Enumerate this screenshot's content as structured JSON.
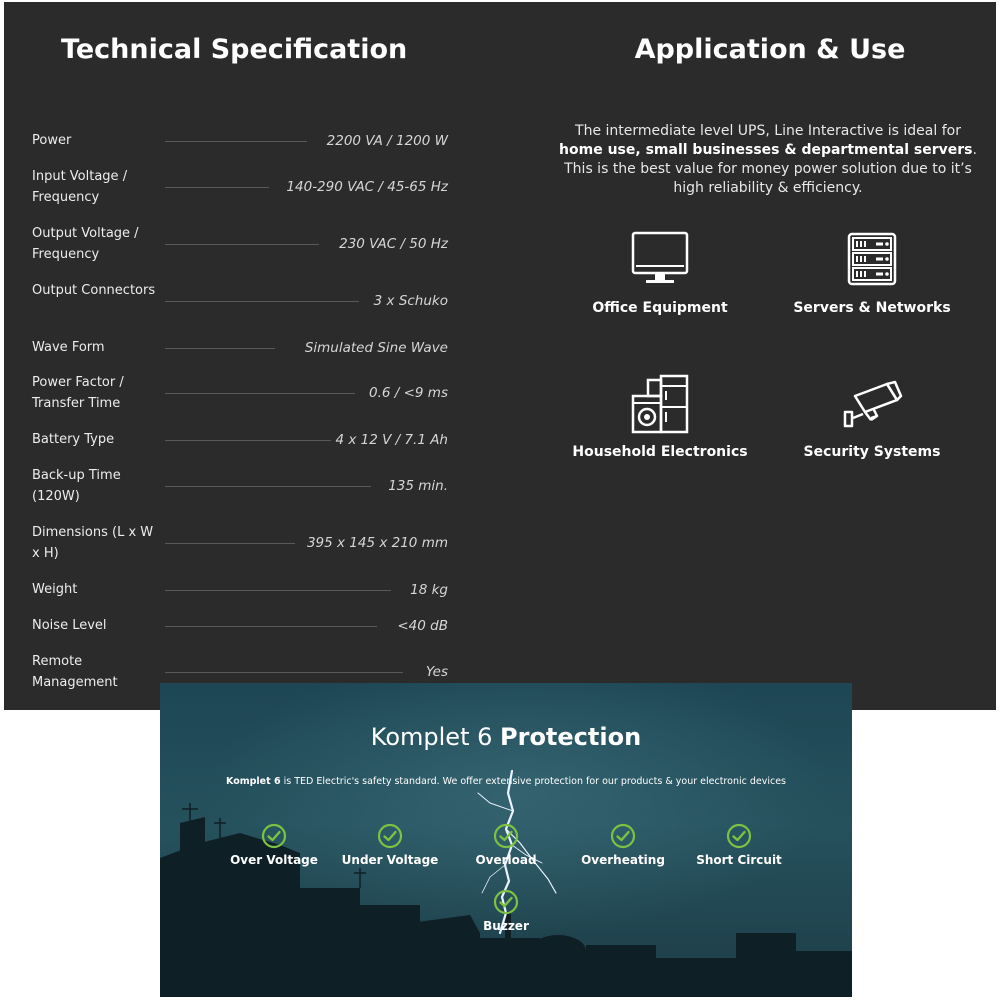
{
  "technical_specification": {
    "title": "Technical Specification",
    "rows": [
      {
        "label": "Power",
        "value": "2200 VA / 1200 W"
      },
      {
        "label": "Input Voltage / Frequency",
        "value": "140-290 VAC / 45-65 Hz"
      },
      {
        "label": "Output Voltage / Frequency",
        "value": "230 VAC / 50 Hz"
      },
      {
        "label": "Output Connectors",
        "value": "3 x Schuko"
      },
      {
        "label": "Wave Form",
        "value": "Simulated Sine Wave"
      },
      {
        "label": "Power Factor / Transfer Time",
        "value": "0.6 / <9 ms"
      },
      {
        "label": "Battery Type",
        "value": "4 x 12 V / 7.1 Ah"
      },
      {
        "label": "Back-up Time (120W)",
        "value": "135 min."
      },
      {
        "label": "Dimensions (L x W x H)",
        "value": "395 x 145 x 210 mm"
      },
      {
        "label": "Weight",
        "value": "18 kg"
      },
      {
        "label": "Noise Level",
        "value": "<40 dB"
      },
      {
        "label": "Remote Management",
        "value": "Yes"
      }
    ]
  },
  "application": {
    "title": "Application & Use",
    "desc_part1": "The intermediate level UPS, Line Interactive is ideal for ",
    "desc_bold": "home use, small businesses & departmental servers",
    "desc_part2": ". This is the best value for money power solution due to it’s high reliability & efficiency.",
    "items": [
      {
        "label": "Office Equipment",
        "icon": "monitor-icon"
      },
      {
        "label": "Servers & Networks",
        "icon": "server-rack-icon"
      },
      {
        "label": "Household Electronics",
        "icon": "appliances-icon"
      },
      {
        "label": "Security Systems",
        "icon": "security-camera-icon"
      }
    ]
  },
  "protection": {
    "title_regular": "Komplet 6 ",
    "title_bold": "Protection",
    "desc_bold": "Komplet 6",
    "desc_rest": " is TED Electric's safety standard. We offer extensive protection for our products & your electronic devices",
    "features": [
      {
        "label": "Over Voltage"
      },
      {
        "label": "Under Voltage"
      },
      {
        "label": "Overload"
      },
      {
        "label": "Overheating"
      },
      {
        "label": "Short Circuit"
      },
      {
        "label": "Buzzer"
      }
    ],
    "check_color": "#7dc242"
  },
  "colors": {
    "panel_dark": "#2b2b2b",
    "banner_teal": "#25515d",
    "accent_green": "#7dc242"
  }
}
